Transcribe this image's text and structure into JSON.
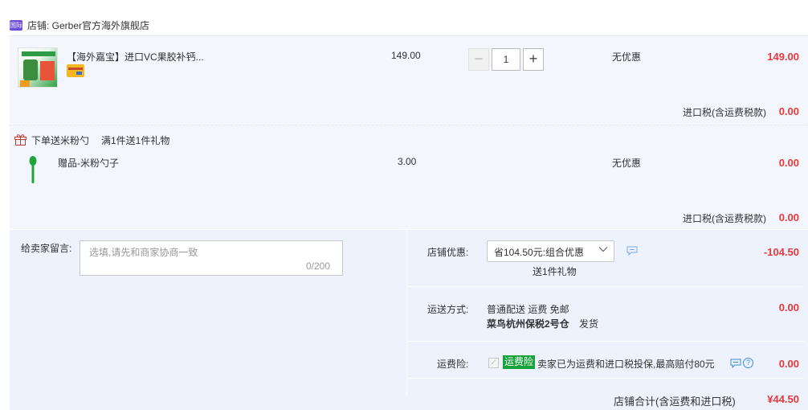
{
  "store": {
    "badge": "国际",
    "name": "店铺: Gerber官方海外旗舰店"
  },
  "item": {
    "title": "【海外嘉宝】进口VC果胶补钙...",
    "price": "149.00",
    "quantity": "1",
    "discount": "无优惠",
    "subtotal": "149.00",
    "tax_label": "进口税(含运费税款)",
    "tax_value": "0.00"
  },
  "gift": {
    "promo_label": "下单送米粉勺",
    "promo_rule": "满1件送1件礼物",
    "title": "赠品-米粉勺子",
    "price": "3.00",
    "discount": "无优惠",
    "subtotal": "0.00",
    "tax_label": "进口税(含运费税款)",
    "tax_value": "0.00"
  },
  "message": {
    "label": "给卖家留言:",
    "placeholder": "选填,请先和商家协商一致",
    "count": "0/200"
  },
  "shop_discount": {
    "label": "店铺优惠:",
    "selected": "省104.50元:组合优惠",
    "note": "送1件礼物",
    "amount": "-104.50"
  },
  "shipping": {
    "label": "运送方式:",
    "method": "普通配送 运费 免邮",
    "warehouse": "菜鸟杭州保税2号仓",
    "ship_suffix": "发货",
    "amount": "0.00"
  },
  "insurance": {
    "label": "运费险:",
    "badge": "运费险",
    "text": "卖家已为运费和进口税投保,最高赔付80元",
    "amount": "0.00"
  },
  "total": {
    "label": "店铺合计(含运费和进口税)",
    "amount": "¥44.50"
  },
  "colors": {
    "price_red": "#e4393c",
    "row_bg": "#f3f6fd",
    "insurance_green": "#16a33c",
    "badge_purple": "#6b4bd9"
  },
  "icons": [
    "tmall-global-badge-icon",
    "card-icon",
    "gift-box-icon",
    "spoon-icon",
    "chevron-down-icon",
    "message-icon",
    "checkbox-icon",
    "help-icon"
  ]
}
